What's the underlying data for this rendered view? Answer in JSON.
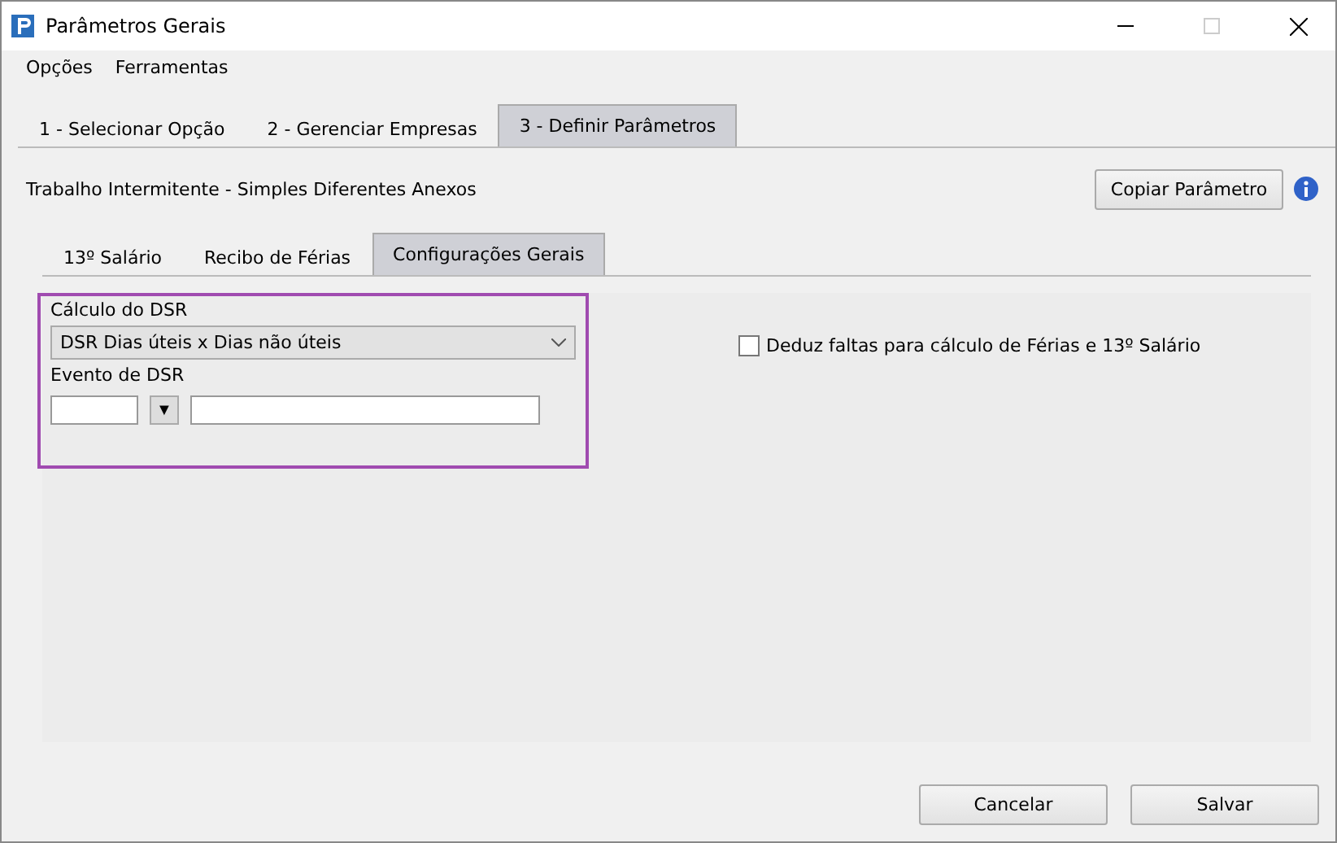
{
  "window": {
    "title": "Parâmetros Gerais"
  },
  "menu": [
    "Opções",
    "Ferramentas"
  ],
  "tabs": [
    {
      "label": "1 - Selecionar Opção",
      "selected": false
    },
    {
      "label": "2 - Gerenciar Empresas",
      "selected": false
    },
    {
      "label": "3 - Definir Parâmetros",
      "selected": true
    }
  ],
  "header": {
    "title": "Trabalho Intermitente - Simples  Diferentes Anexos",
    "copy_button": "Copiar Parâmetro"
  },
  "subtabs": [
    {
      "label": "13º Salário",
      "selected": false
    },
    {
      "label": "Recibo de Férias",
      "selected": false
    },
    {
      "label": "Configurações Gerais",
      "selected": true
    }
  ],
  "dsr": {
    "calc_label": "Cálculo do DSR",
    "calc_value": "DSR Dias úteis x Dias não úteis",
    "event_label": "Evento de DSR",
    "lookup_button": "▼"
  },
  "deduz": {
    "label": "Deduz faltas para cálculo de Férias e 13º Salário",
    "checked": false
  },
  "buttons": [
    "Cancelar",
    "Salvar"
  ]
}
